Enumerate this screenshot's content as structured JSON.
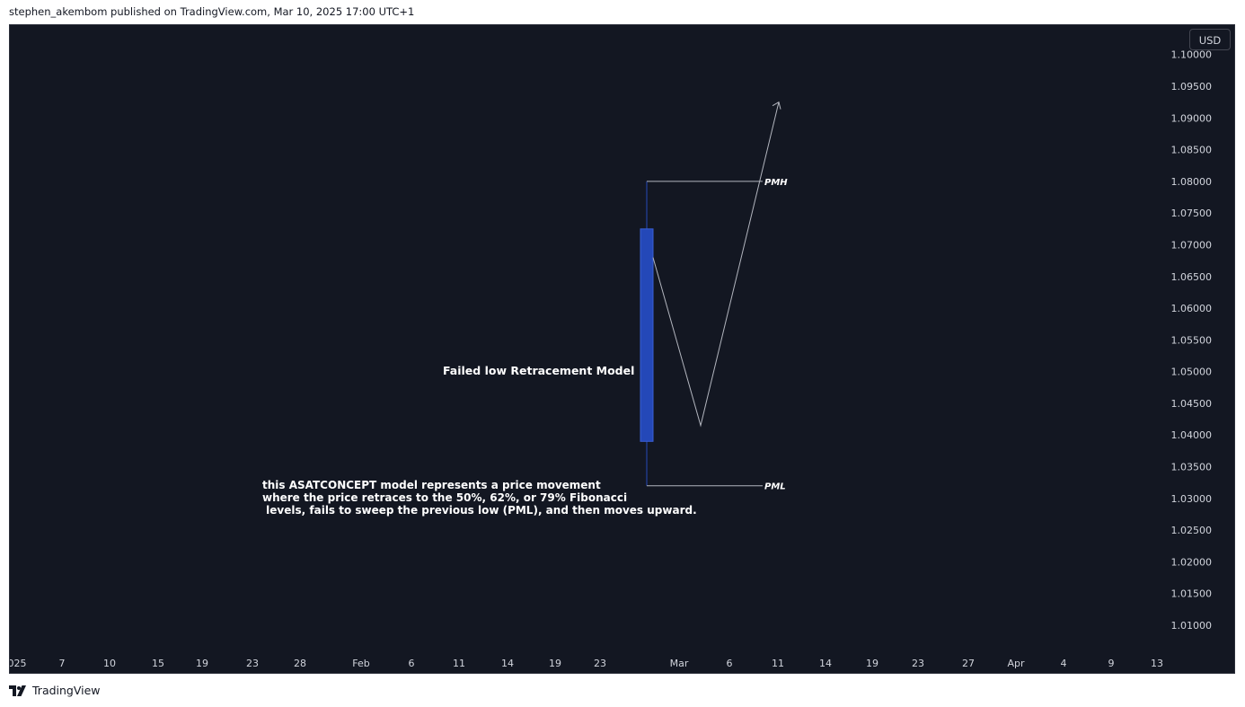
{
  "header": {
    "published_line": "stephen_akembom published on TradingView.com, Mar 10, 2025 17:00 UTC+1"
  },
  "currency_badge": "USD",
  "footer": {
    "brand": "TradingView",
    "logo_icon": "tradingview-logo-icon"
  },
  "colors": {
    "background": "#131722",
    "candle": "#2448b8",
    "axis_text": "#d1d4dc",
    "line": "#b2b5be"
  },
  "chart_data": {
    "type": "candlestick",
    "y_axis": {
      "ticks": [
        "1.01000",
        "1.01500",
        "1.02000",
        "1.02500",
        "1.03000",
        "1.03500",
        "1.04000",
        "1.04500",
        "1.05000",
        "1.05500",
        "1.06000",
        "1.06500",
        "1.07000",
        "1.07500",
        "1.08000",
        "1.08500",
        "1.09000",
        "1.09500",
        "1.10000"
      ],
      "ylim": [
        1.005,
        1.1
      ],
      "position": "right"
    },
    "x_axis": {
      "ticks": [
        "025",
        "7",
        "10",
        "15",
        "19",
        "23",
        "28",
        "Feb",
        "6",
        "11",
        "14",
        "19",
        "23",
        "Mar",
        "6",
        "11",
        "14",
        "19",
        "23",
        "27",
        "Apr",
        "4",
        "9",
        "13"
      ]
    },
    "candle": {
      "open": 1.039,
      "high": 1.08,
      "low": 1.032,
      "close": 1.0725
    },
    "levels": [
      {
        "label": "PMH",
        "value": 1.08
      },
      {
        "label": "PML",
        "value": 1.032
      }
    ],
    "path_prices": [
      1.068,
      1.0415,
      1.0925
    ],
    "annotations": {
      "title": "Failed low Retracement Model",
      "description": [
        "this ASATCONCEPT model represents a price movement",
        "where the price retraces to the 50%, 62%, or 79% Fibonacci",
        " levels, fails to sweep the previous low (PML), and then moves upward."
      ]
    },
    "grid": false
  }
}
